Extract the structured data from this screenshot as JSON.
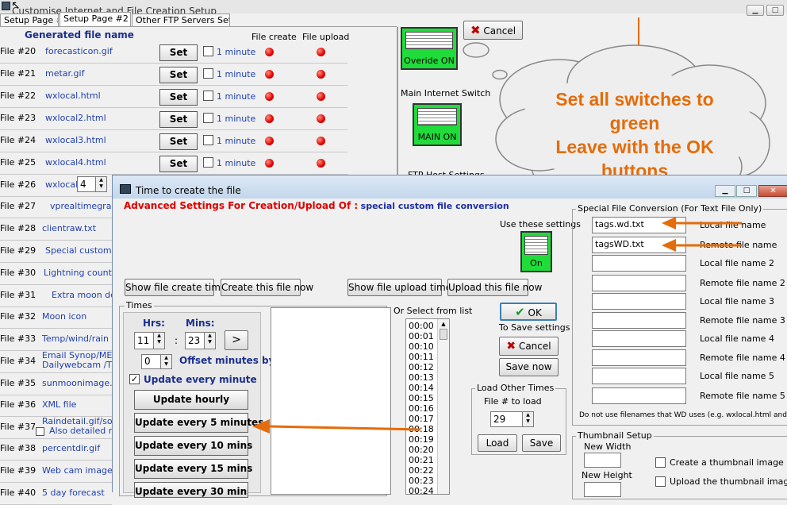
{
  "main_window": {
    "title": "Customise Internet and File Creation Setup",
    "tabs": [
      "Setup Page #1",
      "Setup Page #2",
      "Other FTP Servers Setup"
    ],
    "col_generated": "Generated file name",
    "col_create": "File create",
    "col_upload": "File upload",
    "set_label": "Set",
    "minute_label": "1 minute",
    "rows": [
      {
        "num": "File #20",
        "name": "forecasticon.gif"
      },
      {
        "num": "File #21",
        "name": "metar.gif"
      },
      {
        "num": "File #22",
        "name": "wxlocal.html"
      },
      {
        "num": "File #23",
        "name": "wxlocal2.html"
      },
      {
        "num": "File #24",
        "name": "wxlocal3.html"
      },
      {
        "num": "File #25",
        "name": "wxlocal4.html"
      },
      {
        "num": "File #26",
        "name": "wxlocal",
        "extra": "4"
      },
      {
        "num": "File #27",
        "name": "vprealtimegraph.g"
      },
      {
        "num": "File #28",
        "name": "clientraw.txt"
      },
      {
        "num": "File #29",
        "name": "Special custom file"
      },
      {
        "num": "File #30",
        "name": "Lightning count g"
      },
      {
        "num": "File #31",
        "name": "Extra moon details"
      },
      {
        "num": "File #32",
        "name": "Moon icon"
      },
      {
        "num": "File #33",
        "name": "Temp/wind/rain tr"
      },
      {
        "num": "File #34",
        "name": "Email Synop/METAR",
        "name2": "Dailywebcam /Tid"
      },
      {
        "num": "File #35",
        "name": "sunmoonimage.jpg"
      },
      {
        "num": "File #36",
        "name": "XML file"
      },
      {
        "num": "File #37",
        "name": "Raindetail.gif/solar",
        "name2": "Also detailed rain"
      },
      {
        "num": "File #38",
        "name": "percentdir.gif"
      },
      {
        "num": "File #39",
        "name": "Web cam images"
      },
      {
        "num": "File #40",
        "name": "5 day forecast"
      }
    ],
    "cancel_label": "Cancel",
    "override_label": "Overide ON",
    "main_switch_title": "Main Internet Switch",
    "main_on_label": "MAIN ON",
    "ftp_settings": "FTP Host Settings"
  },
  "annotation": {
    "line1": "Set all switches to",
    "line2": "green",
    "line3": "Leave with the OK",
    "line4": "buttons",
    "color": "#e46c0a"
  },
  "dialog": {
    "title": "Time to create the file",
    "heading": "Advanced Settings For Creation/Upload Of :",
    "heading_value": "special custom file conversion",
    "use_settings": "Use these settings",
    "on_label": "On",
    "btn_show_create": "Show file create times",
    "btn_create_now": "Create this file now",
    "btn_show_upload": "Show file upload times",
    "btn_upload_now": "Upload this file now",
    "times_group": "Times",
    "hrs_label": "Hrs:",
    "mins_label": "Mins:",
    "hrs_value": "11",
    "mins_value": "23",
    "colon": ":",
    "arrow_btn": ">",
    "offset_value": "0",
    "offset_label": "Offset minutes by",
    "update_minute": "Update every minute",
    "update_hourly": "Update hourly",
    "update_5": "Update every 5 minutes",
    "update_10": "Update every 10 mins",
    "update_15": "Update every 15 mins",
    "update_30": "Update every 30 mins",
    "or_select": "Or Select from list",
    "time_list": [
      "00:00",
      "00:01",
      "00:10",
      "00:11",
      "00:12",
      "00:13",
      "00:14",
      "00:15",
      "00:16",
      "00:17",
      "00:18",
      "00:19",
      "00:20",
      "00:21",
      "00:22",
      "00:23",
      "00:24"
    ],
    "ok_label": "OK",
    "to_save": "To Save settings",
    "cancel_label": "Cancel",
    "save_now": "Save now",
    "load_other": "Load Other Times",
    "file_to_load": "File # to load",
    "load_value": "29",
    "load_btn": "Load",
    "save_btn": "Save",
    "special_group": "Special File Conversion (For Text File Only)",
    "conversions": [
      {
        "value": "tags.wd.txt",
        "label": "Local file name"
      },
      {
        "value": "tagsWD.txt",
        "label": "Remote file name"
      },
      {
        "value": "",
        "label": "Local file name 2"
      },
      {
        "value": "",
        "label": "Remote file name 2"
      },
      {
        "value": "",
        "label": "Local file name 3"
      },
      {
        "value": "",
        "label": "Remote file name 3"
      },
      {
        "value": "",
        "label": "Local file name 4"
      },
      {
        "value": "",
        "label": "Remote file name 4"
      },
      {
        "value": "",
        "label": "Local file name 5"
      },
      {
        "value": "",
        "label": "Remote file name 5"
      }
    ],
    "special_note": "Do not use filenames that WD uses (e.g. wxlocal.html and wx.html)",
    "thumb_group": "Thumbnail Setup",
    "new_width": "New Width",
    "new_height": "New Height",
    "create_thumb": "Create a thumbnail image",
    "upload_thumb": "Upload the thumbnail image"
  }
}
